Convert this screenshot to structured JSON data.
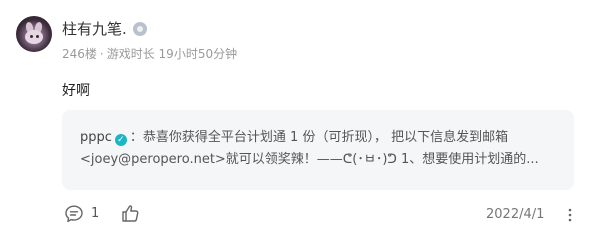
{
  "post": {
    "username": "柱有九笔.",
    "floor": "246楼",
    "separator": "·",
    "playtime": "游戏时长 19小时50分钟",
    "content": "好啊"
  },
  "quote": {
    "author": "pppc",
    "line1": "：恭喜你获得全平台计划通 1 份（可折现）， 把以下信息发到邮箱",
    "line2": "<joey@peropero.net>就可以领奖辣！——ᕦ(･ㅂ･)ᕤ 1、想要使用计划通的..."
  },
  "footer": {
    "comment_count": "1",
    "date": "2022/4/1"
  },
  "colors": {
    "verified": "#1bb6c6",
    "quote_bg": "#f5f6f8"
  },
  "icons": [
    "comment-icon",
    "like-icon",
    "more-icon",
    "verified-icon",
    "level-badge-icon"
  ]
}
